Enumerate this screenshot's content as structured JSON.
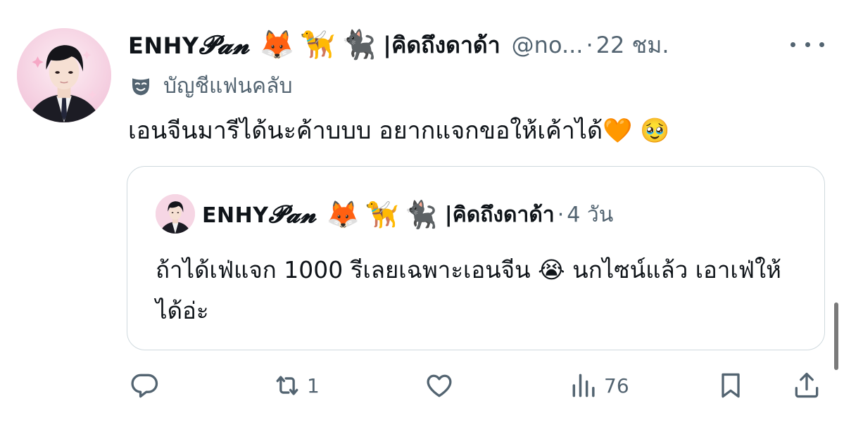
{
  "tweet": {
    "author": {
      "name_prefix": "ENHY",
      "name_script": "𝓟𝓪𝓷",
      "emojis": [
        "🦊",
        "🦮",
        "🐈‍⬛"
      ],
      "name_suffix": "|คิดถึงดาด้า",
      "handle": "@no...",
      "avatar_icon": "profile-photo"
    },
    "separator": "·",
    "time": "22 ชม.",
    "fanclub_label": "บัญชีแฟนคลับ",
    "fanclub_icon": "mask-icon",
    "text": "เอนจีนมารีได้นะค้าบบบ อยากแจกขอให้เค้าได้🧡 🥹",
    "quoted": {
      "name_prefix": "ENHY",
      "name_script": "𝓟𝓪𝓷",
      "emojis": [
        "🦊",
        "🦮",
        "🐈‍⬛"
      ],
      "name_suffix": "|คิดถึงดาด้า",
      "separator": "·",
      "time": "4 วัน",
      "text": "ถ้าได้เฟ่แจก 1000 รีเลยเฉพาะเอนจีน 😭 นกไซน์แล้ว เอาเฟ่ให้ได้อ่ะ"
    },
    "actions": {
      "reply_icon": "reply-icon",
      "retweet_icon": "retweet-icon",
      "retweet_count": "1",
      "like_icon": "heart-icon",
      "views_icon": "views-icon",
      "views_count": "76",
      "bookmark_icon": "bookmark-icon",
      "share_icon": "share-icon"
    }
  },
  "colors": {
    "text": "#0f1419",
    "secondary": "#536471",
    "border": "#cfd9de",
    "background": "#ffffff"
  }
}
